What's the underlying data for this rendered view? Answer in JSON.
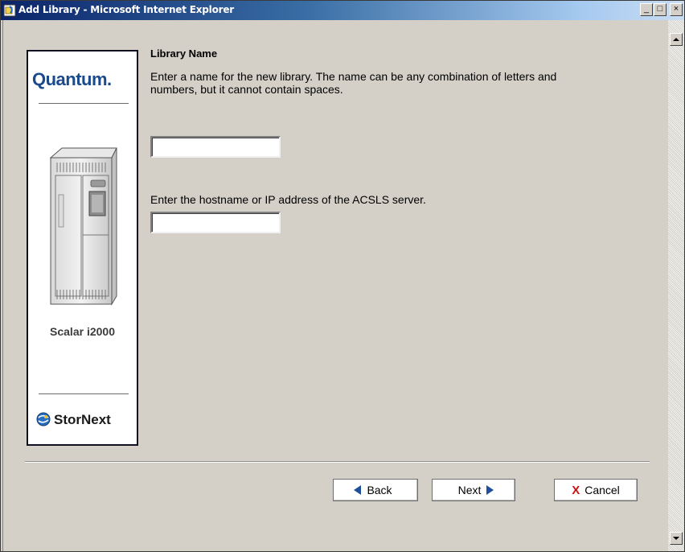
{
  "window": {
    "title": "Add Library - Microsoft Internet Explorer",
    "controls": {
      "minimize": "_",
      "maximize": "□",
      "close": "×"
    }
  },
  "brand": {
    "company": "Quantum.",
    "model": "Scalar i2000",
    "product": "StorNext"
  },
  "form": {
    "section_title": "Library Name",
    "name_description": "Enter a name for the new library. The name can be any combination of letters and numbers, but it cannot contain spaces.",
    "name_value": "",
    "host_description": "Enter the hostname or IP address of the ACSLS server.",
    "host_value": ""
  },
  "buttons": {
    "back": "Back",
    "next": "Next",
    "cancel": "Cancel"
  },
  "icons": {
    "app": "ie-icon",
    "back": "left-arrow-icon",
    "next": "right-arrow-icon",
    "cancel": "x-icon",
    "stornext": "globe-icon"
  },
  "colors": {
    "titlebar_start": "#0a246a",
    "titlebar_end": "#c9ddf2",
    "brand_blue": "#1a4a8c",
    "arrow_blue": "#1f4f9a",
    "cancel_red": "#d01010"
  }
}
